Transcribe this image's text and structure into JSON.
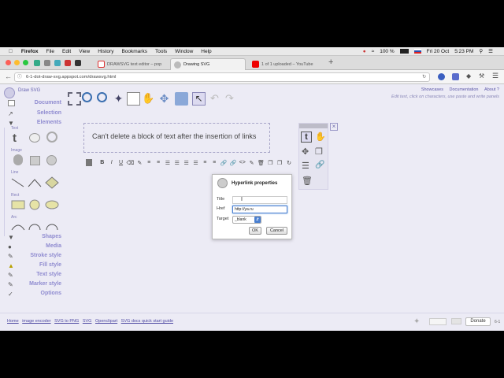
{
  "menubar": {
    "items": [
      "Firefox",
      "File",
      "Edit",
      "View",
      "History",
      "Bookmarks",
      "Tools",
      "Window",
      "Help"
    ],
    "status": {
      "battery": "100 %",
      "date": "Fri 20 Oct",
      "time": "5:23 PM"
    }
  },
  "tabs": [
    {
      "label": "DRAWSVG text editor – pop",
      "color": "#d33"
    },
    {
      "label": "Drawing SVG",
      "color": "#888"
    },
    {
      "label": "1 of 1 uploaded – YouTube",
      "color": "#e00"
    }
  ],
  "url": "6-1-dot-draw-svg.appspot.com/drawsvg.html",
  "app": {
    "brand": "Draw SVG",
    "sidebar_sections": [
      "Document",
      "Selection",
      "Elements",
      "Shapes",
      "Media",
      "Stroke style",
      "Fill style",
      "Text style",
      "Marker style",
      "Options"
    ],
    "element_groups": [
      "Text",
      "Image",
      "Line",
      "Rect",
      "Arc"
    ],
    "nav_links": [
      "Showcases",
      "Documentation",
      "About ?"
    ],
    "hint": "Edit text, click on characters, use paste and write panels",
    "text_content": "Can't delete a block of text after the insertion of links",
    "format_buttons": [
      "B",
      "I",
      "U"
    ]
  },
  "dialog": {
    "title": "Hyperlink properties",
    "title_label": "Title",
    "title_value": "",
    "href_label": "Href",
    "href_value": "http://ya.ru",
    "target_label": "Target",
    "target_value": "_blank",
    "ok": "OK",
    "cancel": "Cancel"
  },
  "footer": {
    "links": [
      "Home",
      "image encoder",
      "SVG to PNG",
      "SVG",
      "Openclipart",
      "SVG docs quick start guide"
    ],
    "donate": "Donate",
    "version": "6-1"
  }
}
